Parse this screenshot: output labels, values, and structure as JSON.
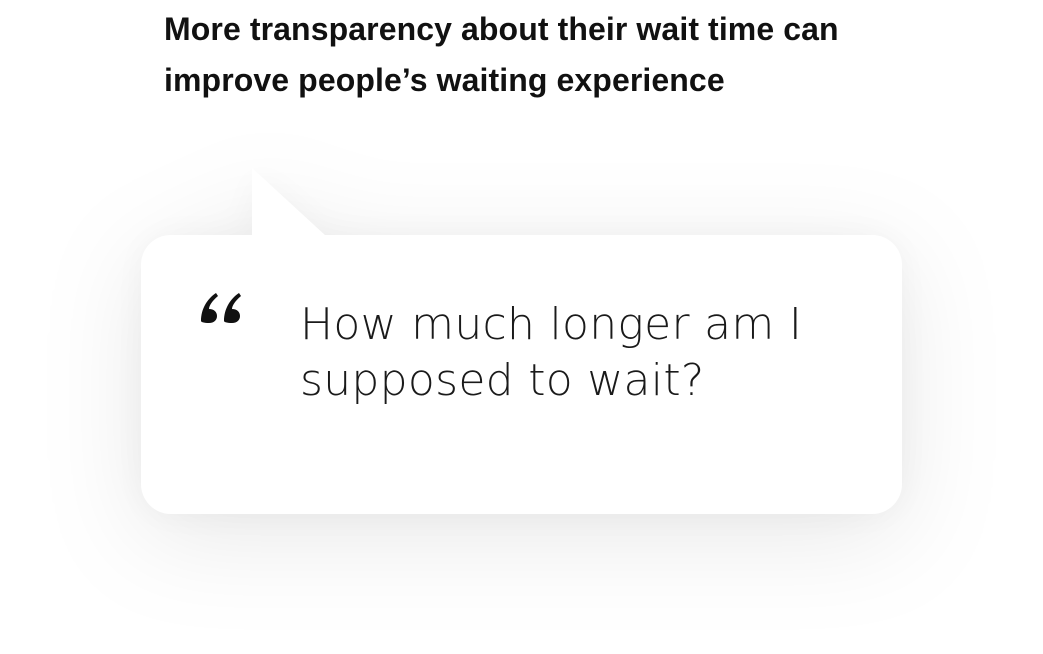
{
  "headline": "More transparency about their wait time can improve people’s waiting experience",
  "quote": {
    "icon": "quote-open-icon",
    "text": "How much longer am I supposed to wait?"
  },
  "colors": {
    "background": "#ffffff",
    "text": "#111111",
    "bubble": "#ffffff"
  }
}
